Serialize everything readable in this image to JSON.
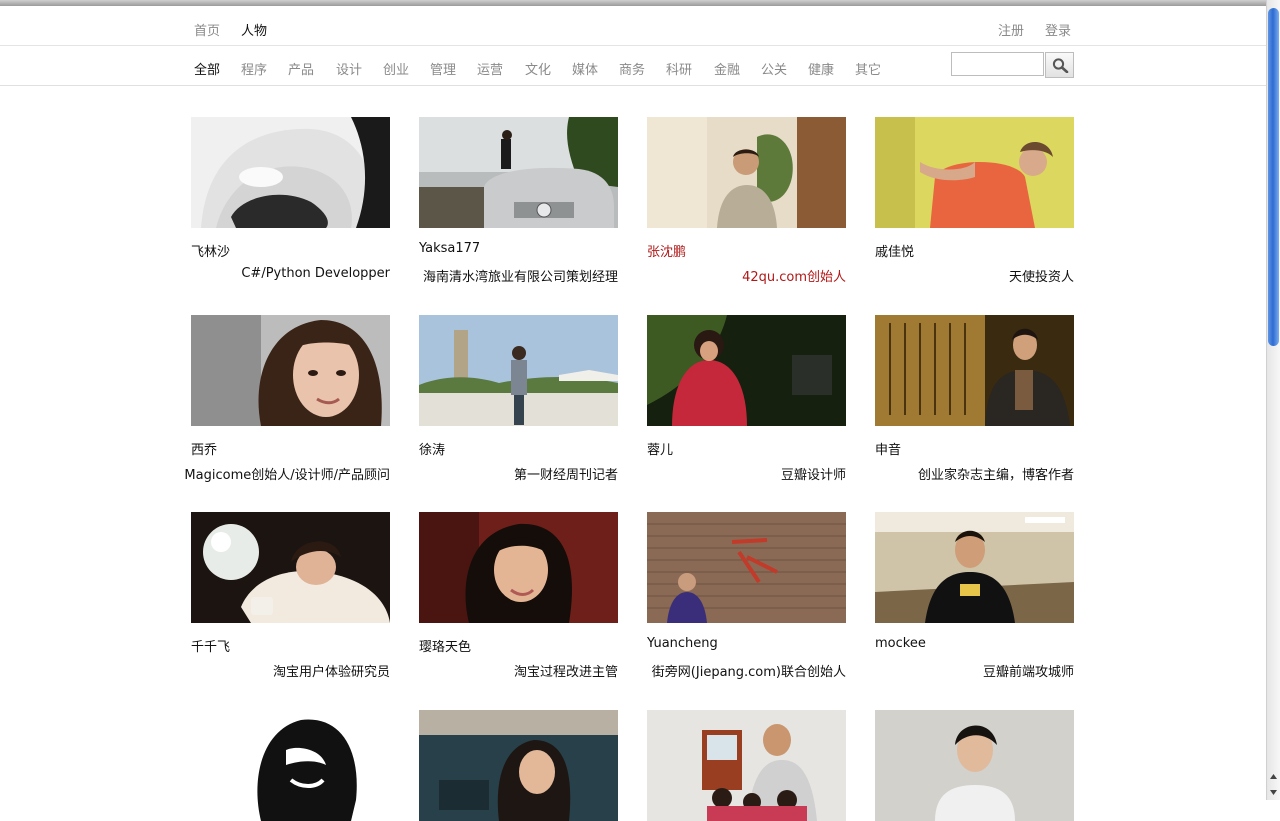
{
  "topnav": {
    "home": "首页",
    "people": "人物",
    "register": "注册",
    "login": "登录"
  },
  "categories": [
    "全部",
    "程序",
    "产品",
    "设计",
    "创业",
    "管理",
    "运营",
    "文化",
    "媒体",
    "商务",
    "科研",
    "金融",
    "公关",
    "健康",
    "其它"
  ],
  "search": {
    "placeholder": ""
  },
  "people": [
    {
      "name": "飞林沙",
      "title": "C#/Python Developper"
    },
    {
      "name": "Yaksa177",
      "title": "海南清水湾旅业有限公司策划经理"
    },
    {
      "name": "张沈鹏",
      "title": "42qu.com创始人"
    },
    {
      "name": "戚佳悦",
      "title": "天使投资人"
    },
    {
      "name": "西乔",
      "title": "Magicome创始人/设计师/产品顾问"
    },
    {
      "name": "徐涛",
      "title": "第一财经周刊记者"
    },
    {
      "name": "蓉儿",
      "title": "豆瓣设计师"
    },
    {
      "name": "申音",
      "title": "创业家杂志主编，博客作者"
    },
    {
      "name": "千千飞",
      "title": "淘宝用户体验研究员"
    },
    {
      "name": "璎珞天色",
      "title": "淘宝过程改进主管"
    },
    {
      "name": "Yuancheng",
      "title": "街旁网(Jiepang.com)联合创始人"
    },
    {
      "name": "mockee",
      "title": "豆瓣前端攻城师"
    },
    {
      "name": "",
      "title": ""
    },
    {
      "name": "",
      "title": ""
    },
    {
      "name": "",
      "title": ""
    },
    {
      "name": "",
      "title": ""
    }
  ],
  "colors": {
    "highlight": "#b01818",
    "nav_muted": "#8a8a8a",
    "scroll": "#2d6bd1"
  }
}
